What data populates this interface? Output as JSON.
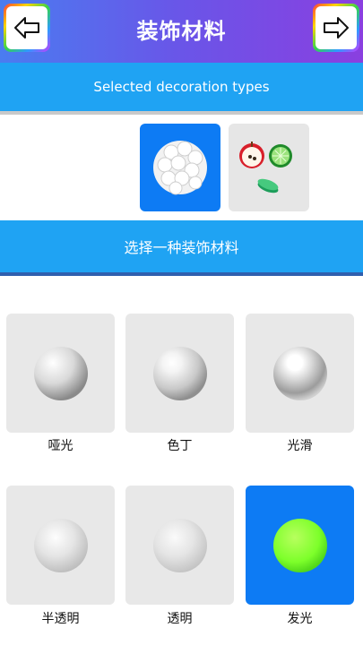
{
  "header": {
    "title": "装饰材料",
    "back_icon": "arrow-left-icon",
    "forward_icon": "arrow-right-icon"
  },
  "selected_bar": {
    "label": "Selected decoration types"
  },
  "decoration_types": [
    {
      "icon": "sprinkle-ball-icon",
      "selected": true
    },
    {
      "icon": "fruit-slices-icon",
      "selected": false
    }
  ],
  "material_bar": {
    "label": "选择一种装饰材料"
  },
  "materials": [
    {
      "label": "哑光",
      "selected": false
    },
    {
      "label": "色丁",
      "selected": false
    },
    {
      "label": "光滑",
      "selected": false
    },
    {
      "label": "半透明",
      "selected": false
    },
    {
      "label": "透明",
      "selected": false
    },
    {
      "label": "发光",
      "selected": true
    }
  ],
  "colors": {
    "accent_blue": "#1fa3f3",
    "selected_blue": "#0d7bf4",
    "glow_green": "#7dff2a"
  }
}
